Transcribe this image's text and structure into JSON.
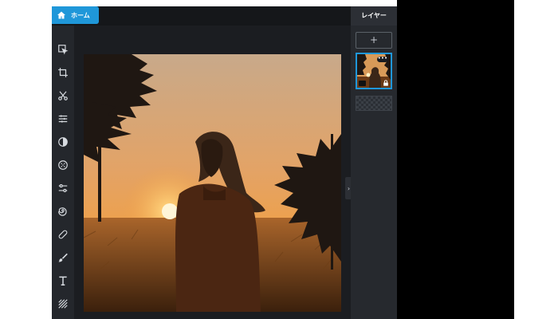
{
  "home_button": {
    "label": "ホーム",
    "icon": "home-icon"
  },
  "tools": [
    {
      "name": "select-tool",
      "icon": "select-arrow-icon"
    },
    {
      "name": "crop-tool",
      "icon": "crop-icon"
    },
    {
      "name": "cutout-tool",
      "icon": "scissors-icon"
    },
    {
      "name": "adjust-tool",
      "icon": "sliders-icon"
    },
    {
      "name": "filter-tool",
      "icon": "half-circle-icon"
    },
    {
      "name": "effects-tool",
      "icon": "dots-grid-icon"
    },
    {
      "name": "liquify-tool",
      "icon": "toggle-sliders-icon"
    },
    {
      "name": "swirl-tool",
      "icon": "swirl-icon"
    },
    {
      "name": "heal-tool",
      "icon": "bandage-icon"
    },
    {
      "name": "brush-tool",
      "icon": "brush-icon"
    },
    {
      "name": "text-tool",
      "icon": "text-icon"
    },
    {
      "name": "texture-tool",
      "icon": "diagonal-lines-icon"
    }
  ],
  "layers_panel": {
    "title": "レイヤー",
    "add_label": "+",
    "thumb_more": "•••"
  },
  "collapse_handle": "›",
  "colors": {
    "accent": "#1f97d9",
    "panel": "#26292e",
    "canvas": "#1b1d21"
  }
}
